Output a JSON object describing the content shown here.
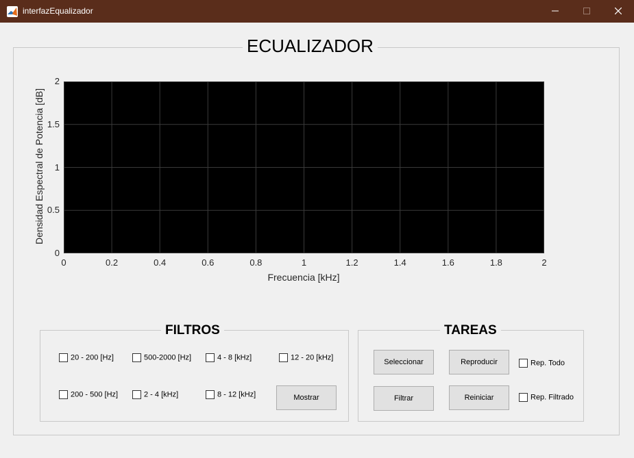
{
  "window": {
    "title": "interfazEqualizador"
  },
  "header": {
    "title": "ECUALIZADOR"
  },
  "plot": {
    "y_ticks": [
      "0",
      "0.5",
      "1",
      "1.5",
      "2"
    ],
    "x_ticks": [
      "0",
      "0.2",
      "0.4",
      "0.6",
      "0.8",
      "1",
      "1.2",
      "1.4",
      "1.6",
      "1.8",
      "2"
    ],
    "xlabel": "Frecuencia [kHz]",
    "ylabel": "Densidad Espectral de Potencia [dB]"
  },
  "chart_data": {
    "type": "line",
    "xlabel": "Frecuencia [kHz]",
    "ylabel": "Densidad Espectral de Potencia [dB]",
    "xlim": [
      0,
      2
    ],
    "ylim": [
      0,
      2
    ],
    "x_ticks": [
      0,
      0.2,
      0.4,
      0.6,
      0.8,
      1,
      1.2,
      1.4,
      1.6,
      1.8,
      2
    ],
    "y_ticks": [
      0,
      0.5,
      1,
      1.5,
      2
    ],
    "grid": true,
    "background": "#000000",
    "series": []
  },
  "filtros": {
    "title": "FILTROS",
    "checkboxes": [
      {
        "label": "20 - 200 [Hz]",
        "checked": false
      },
      {
        "label": "500-2000 [Hz]",
        "checked": false
      },
      {
        "label": "4 - 8 [kHz]",
        "checked": false
      },
      {
        "label": "12 - 20 [kHz]",
        "checked": false
      },
      {
        "label": "200 - 500 [Hz]",
        "checked": false
      },
      {
        "label": "2 - 4 [kHz]",
        "checked": false
      },
      {
        "label": "8 - 12 [kHz]",
        "checked": false
      }
    ],
    "mostrar_label": "Mostrar"
  },
  "tareas": {
    "title": "TAREAS",
    "seleccionar_label": "Seleccionar",
    "reproducir_label": "Reproducir",
    "filtrar_label": "Filtrar",
    "reiniciar_label": "Reiniciar",
    "rep_todo_label": "Rep. Todo",
    "rep_filtrado_label": "Rep. Filtrado"
  },
  "colors": {
    "titlebar": "#5a2d1b",
    "plot_background": "#000000",
    "grid": "#3a3a3a"
  }
}
